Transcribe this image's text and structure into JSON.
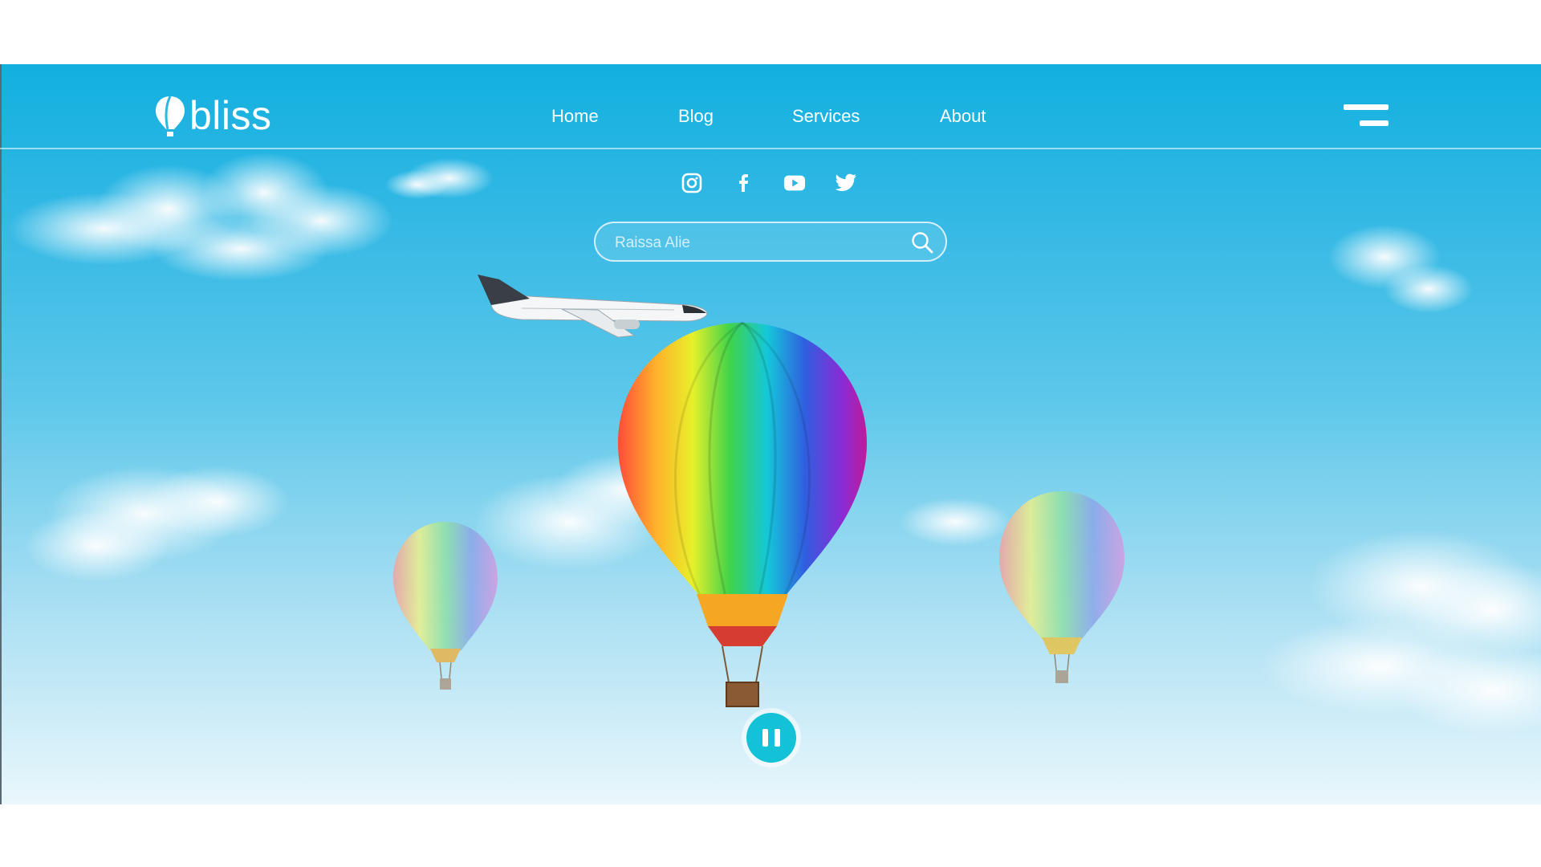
{
  "brand": {
    "name": "bliss",
    "logo_icon": "balloon-logo-icon"
  },
  "nav": {
    "items": [
      {
        "label": "Home"
      },
      {
        "label": "Blog"
      },
      {
        "label": "Services"
      },
      {
        "label": "About"
      }
    ],
    "menu_icon": "hamburger-menu-icon"
  },
  "social": [
    "instagram-icon",
    "facebook-icon",
    "youtube-icon",
    "twitter-icon"
  ],
  "search": {
    "value": "Raissa Alie",
    "icon": "search-icon"
  },
  "player": {
    "control_icon": "pause-icon"
  },
  "colors": {
    "sky_top": "#12b0df",
    "sky_bottom": "#eaf7fc",
    "accent": "#14c2d7",
    "text": "#ffffff"
  }
}
